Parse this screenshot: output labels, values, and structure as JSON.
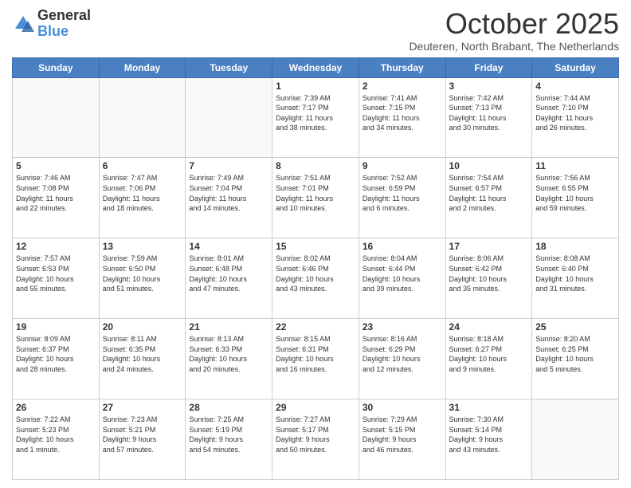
{
  "logo": {
    "general": "General",
    "blue": "Blue"
  },
  "header": {
    "month": "October 2025",
    "location": "Deuteren, North Brabant, The Netherlands"
  },
  "weekdays": [
    "Sunday",
    "Monday",
    "Tuesday",
    "Wednesday",
    "Thursday",
    "Friday",
    "Saturday"
  ],
  "weeks": [
    [
      {
        "day": "",
        "info": ""
      },
      {
        "day": "",
        "info": ""
      },
      {
        "day": "",
        "info": ""
      },
      {
        "day": "1",
        "info": "Sunrise: 7:39 AM\nSunset: 7:17 PM\nDaylight: 11 hours\nand 38 minutes."
      },
      {
        "day": "2",
        "info": "Sunrise: 7:41 AM\nSunset: 7:15 PM\nDaylight: 11 hours\nand 34 minutes."
      },
      {
        "day": "3",
        "info": "Sunrise: 7:42 AM\nSunset: 7:13 PM\nDaylight: 11 hours\nand 30 minutes."
      },
      {
        "day": "4",
        "info": "Sunrise: 7:44 AM\nSunset: 7:10 PM\nDaylight: 11 hours\nand 26 minutes."
      }
    ],
    [
      {
        "day": "5",
        "info": "Sunrise: 7:46 AM\nSunset: 7:08 PM\nDaylight: 11 hours\nand 22 minutes."
      },
      {
        "day": "6",
        "info": "Sunrise: 7:47 AM\nSunset: 7:06 PM\nDaylight: 11 hours\nand 18 minutes."
      },
      {
        "day": "7",
        "info": "Sunrise: 7:49 AM\nSunset: 7:04 PM\nDaylight: 11 hours\nand 14 minutes."
      },
      {
        "day": "8",
        "info": "Sunrise: 7:51 AM\nSunset: 7:01 PM\nDaylight: 11 hours\nand 10 minutes."
      },
      {
        "day": "9",
        "info": "Sunrise: 7:52 AM\nSunset: 6:59 PM\nDaylight: 11 hours\nand 6 minutes."
      },
      {
        "day": "10",
        "info": "Sunrise: 7:54 AM\nSunset: 6:57 PM\nDaylight: 11 hours\nand 2 minutes."
      },
      {
        "day": "11",
        "info": "Sunrise: 7:56 AM\nSunset: 6:55 PM\nDaylight: 10 hours\nand 59 minutes."
      }
    ],
    [
      {
        "day": "12",
        "info": "Sunrise: 7:57 AM\nSunset: 6:53 PM\nDaylight: 10 hours\nand 55 minutes."
      },
      {
        "day": "13",
        "info": "Sunrise: 7:59 AM\nSunset: 6:50 PM\nDaylight: 10 hours\nand 51 minutes."
      },
      {
        "day": "14",
        "info": "Sunrise: 8:01 AM\nSunset: 6:48 PM\nDaylight: 10 hours\nand 47 minutes."
      },
      {
        "day": "15",
        "info": "Sunrise: 8:02 AM\nSunset: 6:46 PM\nDaylight: 10 hours\nand 43 minutes."
      },
      {
        "day": "16",
        "info": "Sunrise: 8:04 AM\nSunset: 6:44 PM\nDaylight: 10 hours\nand 39 minutes."
      },
      {
        "day": "17",
        "info": "Sunrise: 8:06 AM\nSunset: 6:42 PM\nDaylight: 10 hours\nand 35 minutes."
      },
      {
        "day": "18",
        "info": "Sunrise: 8:08 AM\nSunset: 6:40 PM\nDaylight: 10 hours\nand 31 minutes."
      }
    ],
    [
      {
        "day": "19",
        "info": "Sunrise: 8:09 AM\nSunset: 6:37 PM\nDaylight: 10 hours\nand 28 minutes."
      },
      {
        "day": "20",
        "info": "Sunrise: 8:11 AM\nSunset: 6:35 PM\nDaylight: 10 hours\nand 24 minutes."
      },
      {
        "day": "21",
        "info": "Sunrise: 8:13 AM\nSunset: 6:33 PM\nDaylight: 10 hours\nand 20 minutes."
      },
      {
        "day": "22",
        "info": "Sunrise: 8:15 AM\nSunset: 6:31 PM\nDaylight: 10 hours\nand 16 minutes."
      },
      {
        "day": "23",
        "info": "Sunrise: 8:16 AM\nSunset: 6:29 PM\nDaylight: 10 hours\nand 12 minutes."
      },
      {
        "day": "24",
        "info": "Sunrise: 8:18 AM\nSunset: 6:27 PM\nDaylight: 10 hours\nand 9 minutes."
      },
      {
        "day": "25",
        "info": "Sunrise: 8:20 AM\nSunset: 6:25 PM\nDaylight: 10 hours\nand 5 minutes."
      }
    ],
    [
      {
        "day": "26",
        "info": "Sunrise: 7:22 AM\nSunset: 5:23 PM\nDaylight: 10 hours\nand 1 minute."
      },
      {
        "day": "27",
        "info": "Sunrise: 7:23 AM\nSunset: 5:21 PM\nDaylight: 9 hours\nand 57 minutes."
      },
      {
        "day": "28",
        "info": "Sunrise: 7:25 AM\nSunset: 5:19 PM\nDaylight: 9 hours\nand 54 minutes."
      },
      {
        "day": "29",
        "info": "Sunrise: 7:27 AM\nSunset: 5:17 PM\nDaylight: 9 hours\nand 50 minutes."
      },
      {
        "day": "30",
        "info": "Sunrise: 7:29 AM\nSunset: 5:15 PM\nDaylight: 9 hours\nand 46 minutes."
      },
      {
        "day": "31",
        "info": "Sunrise: 7:30 AM\nSunset: 5:14 PM\nDaylight: 9 hours\nand 43 minutes."
      },
      {
        "day": "",
        "info": ""
      }
    ]
  ]
}
